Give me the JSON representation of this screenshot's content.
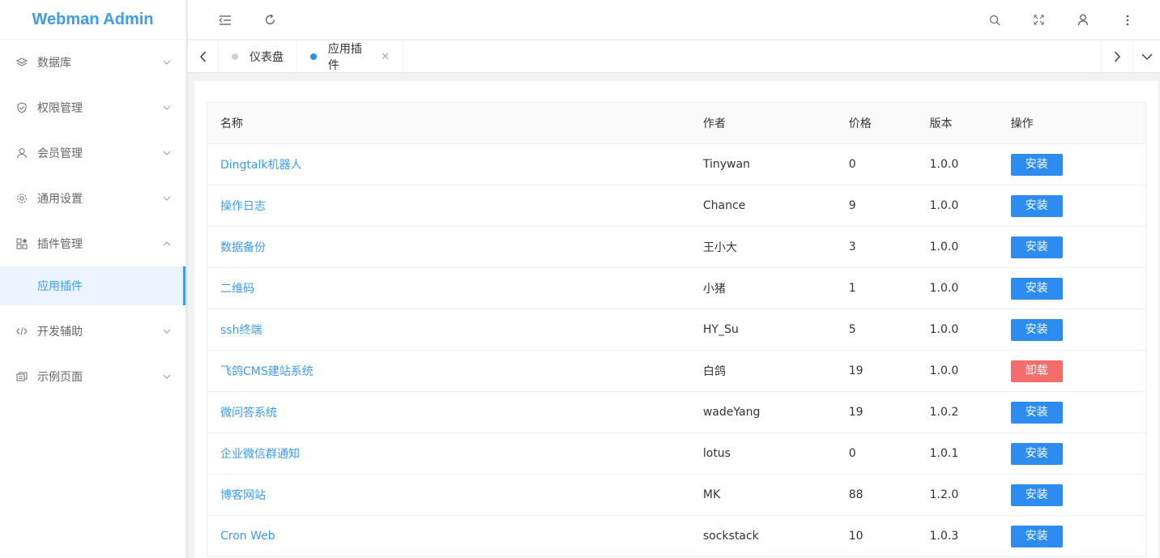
{
  "app": {
    "title": "Webman Admin"
  },
  "sidebar": {
    "items": [
      {
        "label": "数据库",
        "icon": "layers-icon",
        "expanded": false
      },
      {
        "label": "权限管理",
        "icon": "shield-check-icon",
        "expanded": false
      },
      {
        "label": "会员管理",
        "icon": "user-icon",
        "expanded": false
      },
      {
        "label": "通用设置",
        "icon": "gear-icon",
        "expanded": false
      },
      {
        "label": "插件管理",
        "icon": "apps-icon",
        "expanded": true
      },
      {
        "label": "开发辅助",
        "icon": "code-icon",
        "expanded": false
      },
      {
        "label": "示例页面",
        "icon": "pages-icon",
        "expanded": false
      }
    ],
    "submenu": {
      "label": "应用插件"
    }
  },
  "header": {
    "icons": [
      "menu-fold-icon",
      "refresh-icon",
      "search-icon",
      "fullscreen-icon",
      "user-icon",
      "more-vertical-icon"
    ]
  },
  "tabs": [
    {
      "label": "仪表盘",
      "active": false
    },
    {
      "label": "应用插件",
      "active": true,
      "close": "✕"
    }
  ],
  "table": {
    "columns": [
      "名称",
      "作者",
      "价格",
      "版本",
      "操作"
    ],
    "rows": [
      {
        "name": "Dingtalk机器人",
        "author": "Tinywan",
        "price": "0",
        "version": "1.0.0",
        "action": "安装"
      },
      {
        "name": "操作日志",
        "author": "Chance",
        "price": "9",
        "version": "1.0.0",
        "action": "安装"
      },
      {
        "name": "数据备份",
        "author": "王小大",
        "price": "3",
        "version": "1.0.0",
        "action": "安装"
      },
      {
        "name": "二维码",
        "author": "小猪",
        "price": "1",
        "version": "1.0.0",
        "action": "安装"
      },
      {
        "name": "ssh终端",
        "author": "HY_Su",
        "price": "5",
        "version": "1.0.0",
        "action": "安装"
      },
      {
        "name": "飞鸽CMS建站系统",
        "author": "白鸽",
        "price": "19",
        "version": "1.0.0",
        "action": "卸载"
      },
      {
        "name": "微问答系统",
        "author": "wadeYang",
        "price": "19",
        "version": "1.0.2",
        "action": "安装"
      },
      {
        "name": "企业微信群通知",
        "author": "lotus",
        "price": "0",
        "version": "1.0.1",
        "action": "安装"
      },
      {
        "name": "博客网站",
        "author": "MK",
        "price": "88",
        "version": "1.2.0",
        "action": "安装"
      },
      {
        "name": "Cron Web",
        "author": "sockstack",
        "price": "10",
        "version": "1.0.3",
        "action": "安装"
      }
    ]
  },
  "colors": {
    "accent": "#2d8cf0",
    "danger": "#f56c6c",
    "brand": "#3b9cf0"
  }
}
